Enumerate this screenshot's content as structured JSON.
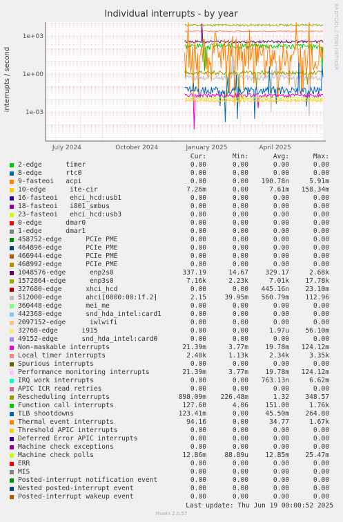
{
  "side_label": "RRDTOOL / TOBI OETIKER",
  "footer": {
    "last_update": "Last update: Thu Jun 19 00:00:52 2025",
    "munin": "Munin 2.0.57"
  },
  "headers": {
    "cur": "Cur:",
    "min": "Min:",
    "avg": "Avg:",
    "max": "Max:"
  },
  "chart_data": {
    "type": "line",
    "title": "Individual interrupts - by year",
    "ylabel": "interrupts / second",
    "yscale": "log",
    "yticks": [
      "1e+03",
      "1e+00",
      "1e-03"
    ],
    "xticks": [
      "July 2024",
      "October 2024",
      "January 2025",
      "April 2025"
    ],
    "grid": true,
    "legend_position": "bottom"
  },
  "legend": [
    {
      "name": "2-edge      timer",
      "color": "#00cc00",
      "cur": "0.00",
      "min": "0.00",
      "avg": "0.00",
      "max": "0.00"
    },
    {
      "name": "8-edge      rtc0",
      "color": "#0066b3",
      "cur": "0.00",
      "min": "0.00",
      "avg": "0.00",
      "max": "0.00"
    },
    {
      "name": "9-fasteoi   acpi",
      "color": "#ff8000",
      "cur": "0.00",
      "min": "0.00",
      "avg": "190.78n",
      "max": "5.91m"
    },
    {
      "name": "10-edge      ite-cir",
      "color": "#ffcc00",
      "cur": "7.26m",
      "min": "0.00",
      "avg": "7.61m",
      "max": "158.34m"
    },
    {
      "name": "16-fasteoi   ehci_hcd:usb1",
      "color": "#330099",
      "cur": "0.00",
      "min": "0.00",
      "avg": "0.00",
      "max": "0.00"
    },
    {
      "name": "18-fasteoi   i801_smbus",
      "color": "#990099",
      "cur": "0.00",
      "min": "0.00",
      "avg": "0.00",
      "max": "0.00"
    },
    {
      "name": "23-fasteoi   ehci_hcd:usb3",
      "color": "#ccff00",
      "cur": "0.00",
      "min": "0.00",
      "avg": "0.00",
      "max": "0.00"
    },
    {
      "name": "0-edge      dmar0",
      "color": "#ff0000",
      "cur": "0.00",
      "min": "0.00",
      "avg": "0.00",
      "max": "0.00"
    },
    {
      "name": "1-edge      dmar1",
      "color": "#808080",
      "cur": "0.00",
      "min": "0.00",
      "avg": "0.00",
      "max": "0.00"
    },
    {
      "name": "458752-edge      PCIe PME",
      "color": "#008f00",
      "cur": "0.00",
      "min": "0.00",
      "avg": "0.00",
      "max": "0.00"
    },
    {
      "name": "464896-edge      PCIe PME",
      "color": "#00487d",
      "cur": "0.00",
      "min": "0.00",
      "avg": "0.00",
      "max": "0.00"
    },
    {
      "name": "466944-edge      PCIe PME",
      "color": "#b35a00",
      "cur": "0.00",
      "min": "0.00",
      "avg": "0.00",
      "max": "0.00"
    },
    {
      "name": "468992-edge      PCIe PME",
      "color": "#b38f00",
      "cur": "0.00",
      "min": "0.00",
      "avg": "0.00",
      "max": "0.00"
    },
    {
      "name": "1048576-edge      enp2s0",
      "color": "#6b006b",
      "cur": "337.19",
      "min": "14.67",
      "avg": "329.17",
      "max": "2.68k"
    },
    {
      "name": "1572864-edge      enp3s0",
      "color": "#8fb300",
      "cur": "7.16k",
      "min": "2.23k",
      "avg": "7.01k",
      "max": "17.78k"
    },
    {
      "name": "327680-edge      xhci_hcd",
      "color": "#b30000",
      "cur": "0.00",
      "min": "0.00",
      "avg": "445.16n",
      "max": "23.10m"
    },
    {
      "name": "512000-edge      ahci[0000:00:1f.2]",
      "color": "#bebebe",
      "cur": "2.15",
      "min": "39.95m",
      "avg": "560.79m",
      "max": "112.96"
    },
    {
      "name": "360448-edge      mei_me",
      "color": "#80ff80",
      "cur": "0.00",
      "min": "0.00",
      "avg": "0.00",
      "max": "0.00"
    },
    {
      "name": "442368-edge      snd_hda_intel:card1",
      "color": "#80c9ff",
      "cur": "0.00",
      "min": "0.00",
      "avg": "0.00",
      "max": "0.00"
    },
    {
      "name": "2097152-edge      iwlwifi",
      "color": "#ffc080",
      "cur": "0.00",
      "min": "0.00",
      "avg": "0.00",
      "max": "0.00"
    },
    {
      "name": "32768-edge      i915",
      "color": "#ffe680",
      "cur": "0.00",
      "min": "0.00",
      "avg": "1.97u",
      "max": "56.10m"
    },
    {
      "name": "49152-edge      snd_hda_intel:card0",
      "color": "#aa80ff",
      "cur": "0.00",
      "min": "0.00",
      "avg": "0.00",
      "max": "0.00"
    },
    {
      "name": "Non-maskable interrupts",
      "color": "#ee00cc",
      "cur": "21.39m",
      "min": "3.77m",
      "avg": "19.78m",
      "max": "124.12m"
    },
    {
      "name": "Local timer interrupts",
      "color": "#ff8080",
      "cur": "2.40k",
      "min": "1.13k",
      "avg": "2.34k",
      "max": "3.35k"
    },
    {
      "name": "Spurious interrupts",
      "color": "#666600",
      "cur": "0.00",
      "min": "0.00",
      "avg": "0.00",
      "max": "0.00"
    },
    {
      "name": "Performance monitoring interrupts",
      "color": "#ffbfff",
      "cur": "21.39m",
      "min": "3.77m",
      "avg": "19.78m",
      "max": "124.12m"
    },
    {
      "name": "IRQ work interrupts",
      "color": "#00ffcc",
      "cur": "0.00",
      "min": "0.00",
      "avg": "763.13n",
      "max": "6.62m"
    },
    {
      "name": "APIC ICR read retries",
      "color": "#cc6699",
      "cur": "0.00",
      "min": "0.00",
      "avg": "0.00",
      "max": "0.00"
    },
    {
      "name": "Rescheduling interrupts",
      "color": "#999900",
      "cur": "898.09m",
      "min": "226.48m",
      "avg": "1.32",
      "max": "348.57"
    },
    {
      "name": "Function call interrupts",
      "color": "#00cc00",
      "cur": "127.60",
      "min": "4.06",
      "avg": "151.00",
      "max": "1.76k"
    },
    {
      "name": "TLB shootdowns",
      "color": "#0066b3",
      "cur": "123.41m",
      "min": "0.00",
      "avg": "45.50m",
      "max": "264.80"
    },
    {
      "name": "Thermal event interrupts",
      "color": "#ff8000",
      "cur": "94.16",
      "min": "0.00",
      "avg": "34.77",
      "max": "1.67k"
    },
    {
      "name": "Threshold APIC interrupts",
      "color": "#ffcc00",
      "cur": "0.00",
      "min": "0.00",
      "avg": "0.00",
      "max": "0.00"
    },
    {
      "name": "Deferred Error APIC interrupts",
      "color": "#330099",
      "cur": "0.00",
      "min": "0.00",
      "avg": "0.00",
      "max": "0.00"
    },
    {
      "name": "Machine check exceptions",
      "color": "#990099",
      "cur": "0.00",
      "min": "0.00",
      "avg": "0.00",
      "max": "0.00"
    },
    {
      "name": "Machine check polls",
      "color": "#ccff00",
      "cur": "12.86m",
      "min": "88.89u",
      "avg": "12.85m",
      "max": "25.47m"
    },
    {
      "name": "ERR",
      "color": "#ff0000",
      "cur": "0.00",
      "min": "0.00",
      "avg": "0.00",
      "max": "0.00"
    },
    {
      "name": "MIS",
      "color": "#808080",
      "cur": "0.00",
      "min": "0.00",
      "avg": "0.00",
      "max": "0.00"
    },
    {
      "name": "Posted-interrupt notification event",
      "color": "#008f00",
      "cur": "0.00",
      "min": "0.00",
      "avg": "0.00",
      "max": "0.00"
    },
    {
      "name": "Nested posted-interrupt event",
      "color": "#00487d",
      "cur": "0.00",
      "min": "0.00",
      "avg": "0.00",
      "max": "0.00"
    },
    {
      "name": "Posted-interrupt wakeup event",
      "color": "#b35a00",
      "cur": "0.00",
      "min": "0.00",
      "avg": "0.00",
      "max": "0.00"
    }
  ]
}
